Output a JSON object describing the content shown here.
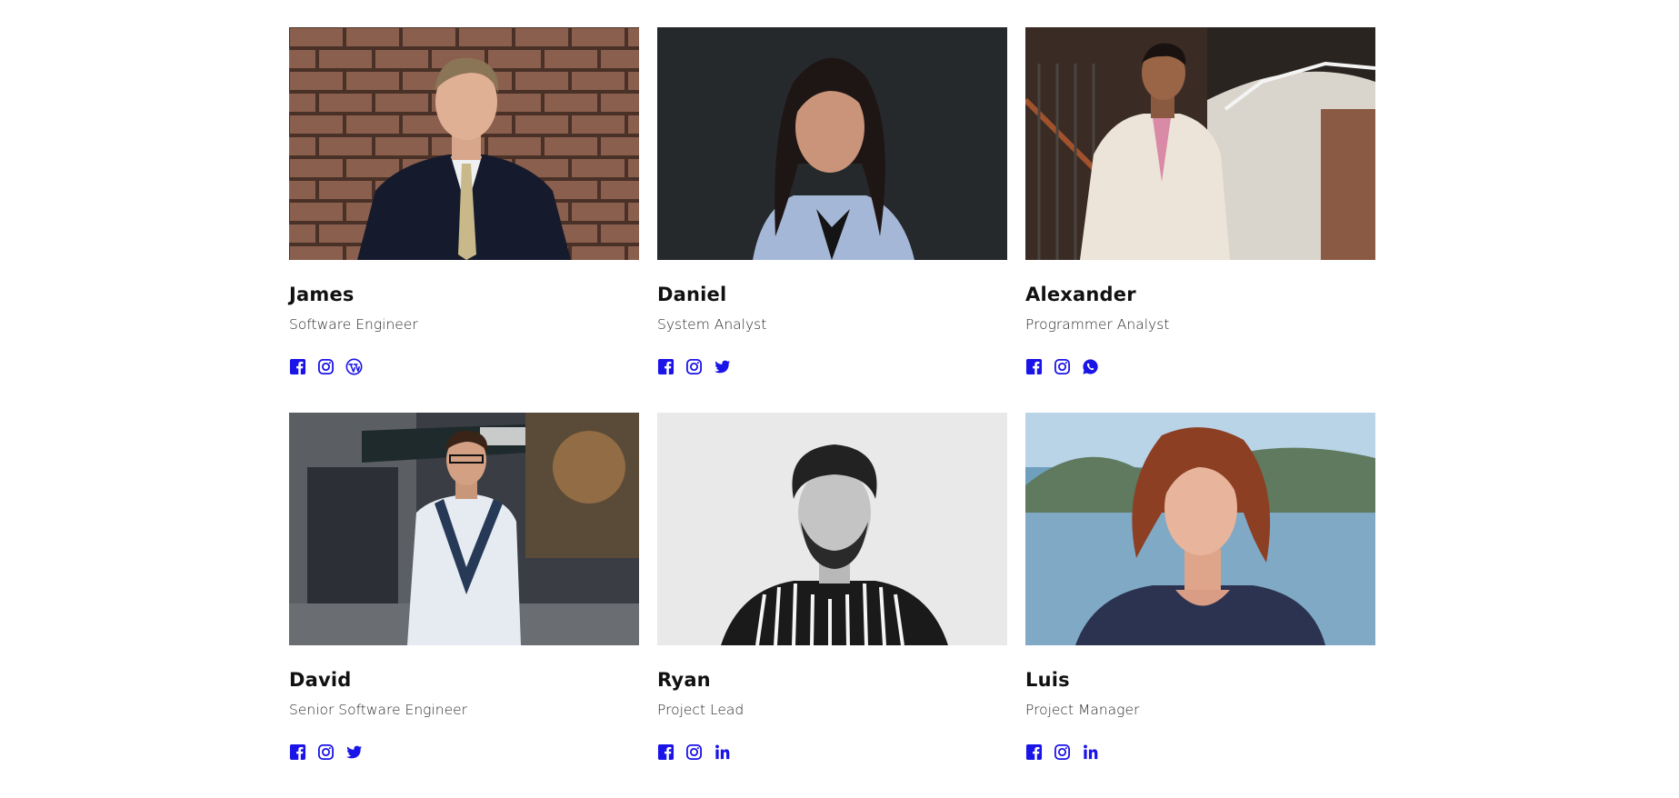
{
  "accent_color": "#1a14e8",
  "members": [
    {
      "name": "James",
      "role": "Software Engineer",
      "icons": [
        "facebook-icon",
        "instagram-icon",
        "wordpress-icon"
      ]
    },
    {
      "name": "Daniel",
      "role": "System Analyst",
      "icons": [
        "facebook-icon",
        "instagram-icon",
        "twitter-icon"
      ]
    },
    {
      "name": "Alexander",
      "role": "Programmer Analyst",
      "icons": [
        "facebook-icon",
        "instagram-icon",
        "whatsapp-icon"
      ]
    },
    {
      "name": "David",
      "role": "Senior Software Engineer",
      "icons": [
        "facebook-icon",
        "instagram-icon",
        "twitter-icon"
      ]
    },
    {
      "name": "Ryan",
      "role": "Project Lead",
      "icons": [
        "facebook-icon",
        "instagram-icon",
        "linkedin-icon"
      ]
    },
    {
      "name": "Luis",
      "role": "Project Manager",
      "icons": [
        "facebook-icon",
        "instagram-icon",
        "linkedin-icon"
      ]
    }
  ]
}
